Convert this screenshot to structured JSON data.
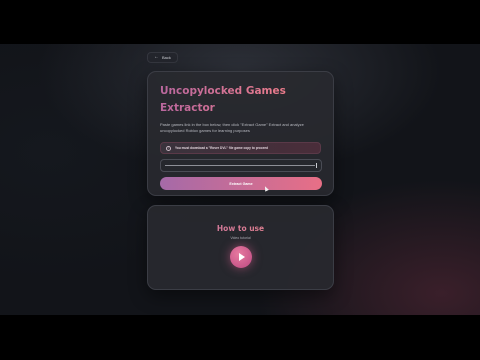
{
  "nav": {
    "back_label": "Back"
  },
  "extractor": {
    "title": "Uncopylocked Games Extractor",
    "description": "Paste games link in the box below, then click \"Extract Game\" Extract and analyze uncopylocked Roblox games for learning purposes",
    "notice": "You must download a \"Rover DVL\" file game copy to proceed",
    "input_value": "",
    "extract_label": "Extract Game"
  },
  "howto": {
    "title": "How to use",
    "subtitle": "Video tutorial"
  },
  "colors": {
    "accent_start": "#a56aa8",
    "accent_end": "#e86f86",
    "background": "#121419"
  }
}
